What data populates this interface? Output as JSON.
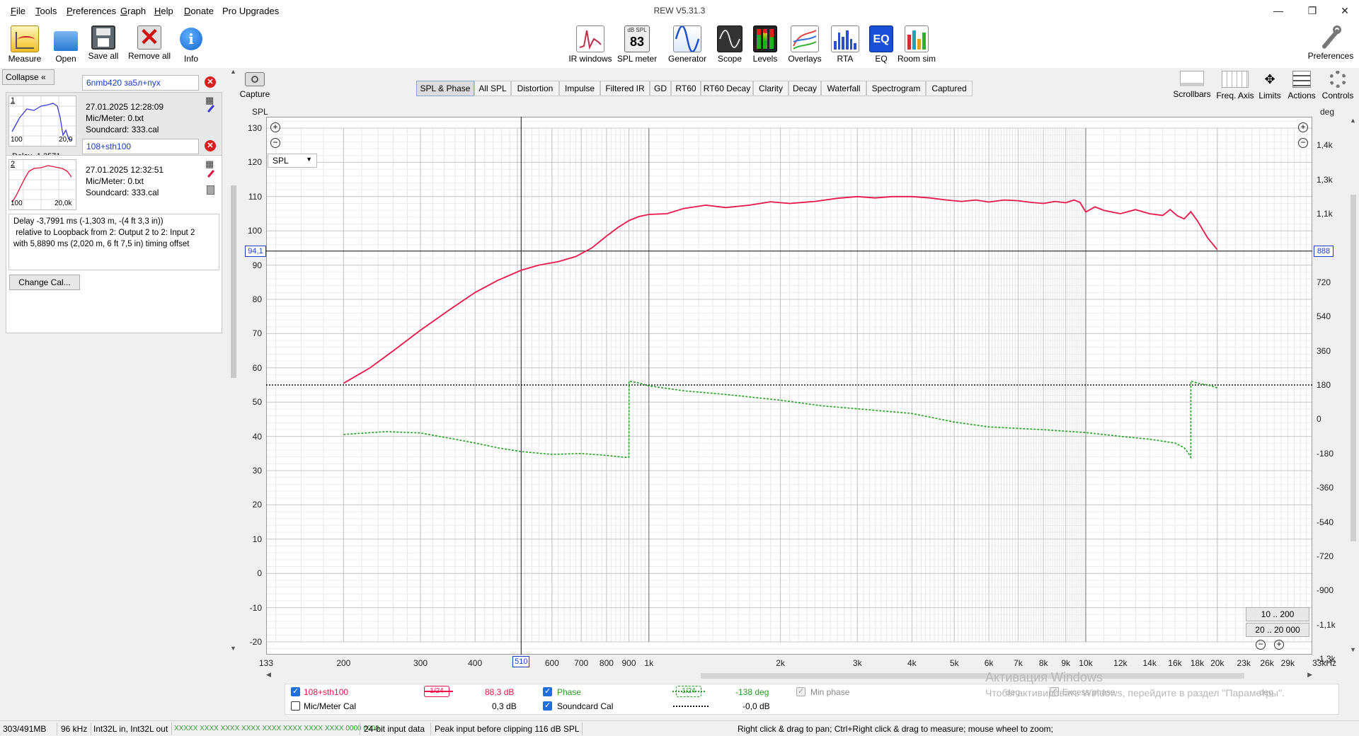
{
  "app": {
    "title": "REW V5.31.3"
  },
  "menu": [
    {
      "label": "File",
      "u": "F",
      "rest": "ile"
    },
    {
      "label": "Tools",
      "u": "T",
      "rest": "ools"
    },
    {
      "label": "Preferences",
      "u": "P",
      "rest": "references"
    },
    {
      "label": "Graph",
      "u": "G",
      "rest": "raph"
    },
    {
      "label": "Help",
      "u": "H",
      "rest": "elp"
    },
    {
      "label": "Donate",
      "u": "D",
      "rest": "onate"
    },
    {
      "label": "Pro Upgrades",
      "u": "",
      "rest": "Pro Upgrades"
    }
  ],
  "toolbar_left": [
    {
      "label": "Measure",
      "icon": "measure-icon"
    },
    {
      "label": "Open",
      "icon": "folder-icon"
    },
    {
      "label": "Save all",
      "icon": "save-icon"
    },
    {
      "label": "Remove all",
      "icon": "remove-all-icon"
    },
    {
      "label": "Info",
      "icon": "info-icon"
    }
  ],
  "toolbar_center": [
    {
      "label": "IR windows",
      "icon": "ir-windows-icon"
    },
    {
      "label": "SPL meter",
      "icon": "spl-meter-icon",
      "badge_top": "dB SPL",
      "badge_val": "83"
    },
    {
      "label": "Generator",
      "icon": "generator-icon"
    },
    {
      "label": "Scope",
      "icon": "scope-icon"
    },
    {
      "label": "Levels",
      "icon": "levels-icon"
    },
    {
      "label": "Overlays",
      "icon": "overlays-icon"
    },
    {
      "label": "RTA",
      "icon": "rta-icon"
    },
    {
      "label": "EQ",
      "icon": "eq-icon",
      "badge_val": "EQ"
    },
    {
      "label": "Room sim",
      "icon": "room-sim-icon"
    }
  ],
  "toolbar_right": {
    "label": "Preferences",
    "icon": "wrench-icon"
  },
  "left_panel": {
    "collapse_label": "Collapse",
    "measurements": [
      {
        "index": "1",
        "name": "6nmb420 за5л+пух",
        "date": "27.01.2025 12:28:09",
        "mic": "Mic/Meter: 0.txt",
        "soundcard": "Soundcard: 333.cal",
        "thumb_x_min": "100",
        "thumb_x_max": "20,0",
        "color": "#3a3adf",
        "partial": "Delay -1,3571"
      },
      {
        "index": "2",
        "name": "108+sth100",
        "date": "27.01.2025 12:32:51",
        "mic": "Mic/Meter: 0.txt",
        "soundcard": "Soundcard: 333.cal",
        "thumb_x_min": "100",
        "thumb_x_max": "20,0k",
        "color": "#e0103c",
        "delay_lines": [
          "Delay -3,7991 ms (-1,303 m, -(4 ft 3,3 in))",
          " relative to Loopback from 2: Output 2 to 2: Input 2",
          "with 5,8890 ms (2,020 m, 6 ft 7,5 in) timing offset"
        ]
      }
    ],
    "change_cal_label": "Change Cal..."
  },
  "capture_label": "Capture",
  "tabs": [
    "SPL & Phase",
    "All SPL",
    "Distortion",
    "Impulse",
    "Filtered IR",
    "GD",
    "RT60",
    "RT60 Decay",
    "Clarity",
    "Decay",
    "Waterfall",
    "Spectrogram",
    "Captured"
  ],
  "active_tab": "SPL & Phase",
  "right_tools": [
    {
      "label": "Scrollbars",
      "icon": "scrollbars-icon"
    },
    {
      "label": "Freq. Axis",
      "icon": "freq-axis-icon"
    },
    {
      "label": "Limits",
      "icon": "limits-icon"
    },
    {
      "label": "Actions",
      "icon": "actions-icon"
    },
    {
      "label": "Controls",
      "icon": "controls-icon"
    }
  ],
  "graph": {
    "left_axis_title": "SPL",
    "right_axis_title": "deg",
    "y_select": "SPL",
    "cursor_y_left": "94,1",
    "cursor_y_right": "888",
    "cursor_x": "510",
    "x_min_label": "133",
    "x_max_label": "33kHz",
    "range_btn_1": "10 .. 200",
    "range_btn_2": "20 .. 20 000",
    "watermark_1": "Активация Windows",
    "watermark_2": "Чтобы активировать Windows, перейдите в раздел \"Параметры\"."
  },
  "chart_data": {
    "type": "line",
    "xlabel": "",
    "ylabel": "SPL",
    "y2label": "deg",
    "x_scale": "log",
    "xlim": [
      133,
      33000
    ],
    "ylim": [
      -25,
      133
    ],
    "y2lim": [
      -1350,
      1650
    ],
    "y_ticks": [
      130,
      120,
      110,
      100,
      90,
      80,
      70,
      60,
      50,
      40,
      30,
      20,
      10,
      0,
      -10,
      -20
    ],
    "y2_ticks": [
      "1,4k",
      "1,3k",
      "1,1k",
      "888",
      "720",
      "540",
      "360",
      "180",
      "0",
      "-180",
      "-360",
      "-540",
      "-720",
      "-900",
      "-1,1k",
      "-1,3k"
    ],
    "x_ticks": [
      "200",
      "300",
      "400",
      "510",
      "600",
      "700",
      "800",
      "900",
      "1k",
      "2k",
      "3k",
      "4k",
      "5k",
      "6k",
      "7k",
      "8k",
      "9k",
      "10k",
      "12k",
      "14k",
      "16k",
      "18k",
      "20k",
      "23k",
      "26k",
      "29k"
    ],
    "grid": true,
    "series": [
      {
        "name": "108+sth100",
        "color": "#e8144a",
        "axis": "left",
        "x": [
          200,
          230,
          260,
          300,
          350,
          400,
          450,
          510,
          560,
          620,
          680,
          740,
          800,
          850,
          900,
          950,
          1000,
          1100,
          1200,
          1350,
          1500,
          1700,
          1900,
          2100,
          2400,
          2700,
          3000,
          3300,
          3600,
          4000,
          4400,
          4800,
          5200,
          5600,
          6000,
          6500,
          7000,
          7500,
          8000,
          8500,
          9000,
          9400,
          9700,
          10000,
          10500,
          11000,
          12000,
          13000,
          14000,
          15000,
          15600,
          16200,
          16800,
          17400,
          18000,
          19000,
          20000
        ],
        "y": [
          55.5,
          60,
          65,
          71,
          77,
          82,
          85.5,
          88.5,
          90,
          91,
          92.5,
          95,
          98.5,
          101,
          103,
          104.2,
          104.8,
          105,
          106.5,
          107.5,
          106.8,
          107.5,
          108.5,
          108,
          108.6,
          109.5,
          110,
          109.6,
          110,
          110,
          109.6,
          109,
          108.6,
          109,
          108.4,
          109,
          108.8,
          108.3,
          108,
          108.6,
          108.2,
          109,
          108.3,
          105.5,
          107,
          106,
          105,
          106.2,
          105,
          104.5,
          106.2,
          104.4,
          103.5,
          105.6,
          103,
          98,
          94.5
        ]
      },
      {
        "name": "Phase",
        "color": "#22a020",
        "axis": "right",
        "style": "dashed",
        "x": [
          200,
          250,
          300,
          350,
          400,
          450,
          510,
          600,
          700,
          800,
          880,
          900,
          901,
          950,
          1000,
          1200,
          1500,
          2000,
          2500,
          3000,
          4000,
          5000,
          6000,
          8000,
          10000,
          12000,
          14000,
          16000,
          16800,
          17200,
          17400,
          17401,
          18000,
          19000,
          20000
        ],
        "y": [
          -80,
          -65,
          -72,
          -100,
          -125,
          -150,
          -170,
          -185,
          -180,
          -190,
          -200,
          -200,
          200,
          190,
          175,
          150,
          130,
          100,
          70,
          55,
          30,
          -15,
          -40,
          -55,
          -70,
          -90,
          -105,
          -125,
          -150,
          -180,
          -200,
          200,
          190,
          180,
          165
        ]
      }
    ],
    "hlines": [
      {
        "name": "Mic/Meter Cal",
        "y": 180,
        "axis": "right",
        "color": "#111"
      }
    ]
  },
  "legend": {
    "row1": {
      "name": "108+sth100",
      "smoothing": "1/24",
      "value": "88,3 dB",
      "phase_label": "Phase",
      "phase_smoothing": "1/24",
      "phase_value": "-138 deg",
      "minphase_label": "Min phase",
      "excess_label": "Excess phase",
      "excess_value": "deg"
    },
    "row2": {
      "name": "Mic/Meter Cal",
      "value": "0,3 dB",
      "sc_label": "Soundcard Cal",
      "sc_value": "-0,0 dB",
      "ghost": "deg"
    }
  },
  "status": {
    "memory": "303/491MB",
    "rate": "96 kHz",
    "format": "Int32L in, Int32L out",
    "bits": "XXXXX XXXX  XXXX XXXX  XXXX XXXX  XXXX XXXX  0000 0000",
    "input_data": "24-bit input data",
    "peak": "Peak input before clipping 116 dB SPL",
    "hint": "Right click & drag to pan; Ctrl+Right click & drag to measure; mouse wheel to zoom;"
  }
}
